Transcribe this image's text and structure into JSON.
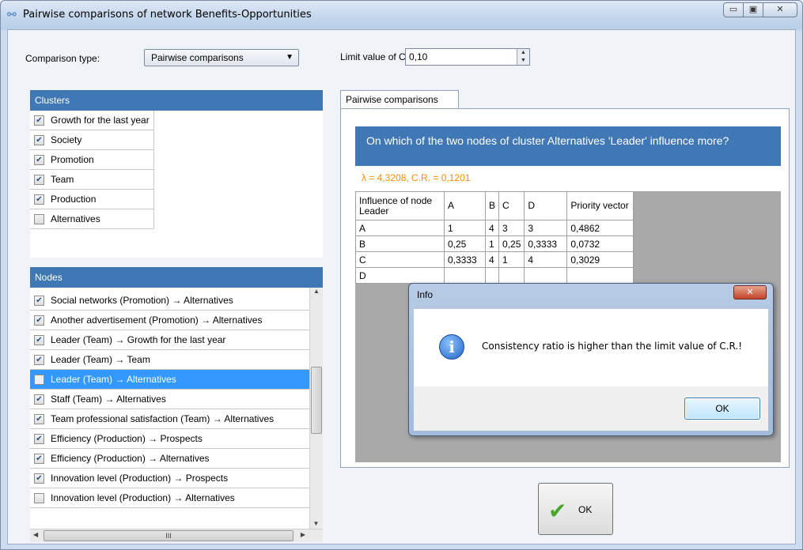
{
  "window": {
    "title": "Pairwise comparisons of network Benefits-Opportunities",
    "min": "▭",
    "max": "▣",
    "close": "✕"
  },
  "controls": {
    "comparison_type_label": "Comparison type:",
    "comparison_type_value": "Pairwise comparisons",
    "limit_label": "Limit value of C.R.",
    "limit_value": "0,10"
  },
  "clusters": {
    "header": "Clusters",
    "items": [
      {
        "label": "Growth for the last year",
        "checked": true
      },
      {
        "label": "Society",
        "checked": true
      },
      {
        "label": "Promotion",
        "checked": true
      },
      {
        "label": "Team",
        "checked": true
      },
      {
        "label": "Production",
        "checked": true
      },
      {
        "label": "Alternatives",
        "checked": false
      }
    ]
  },
  "nodes": {
    "header": "Nodes",
    "items": [
      {
        "label": "Social networks (Promotion) → Alternatives",
        "checked": true
      },
      {
        "label": "Another advertisement (Promotion) → Alternatives",
        "checked": true
      },
      {
        "label": "Leader (Team) → Growth for the last year",
        "checked": true
      },
      {
        "label": "Leader (Team) → Team",
        "checked": true
      },
      {
        "label": "Leader (Team) → Alternatives",
        "checked": false,
        "selected": true
      },
      {
        "label": "Staff (Team) → Alternatives",
        "checked": true
      },
      {
        "label": "Team professional satisfaction (Team) → Alternatives",
        "checked": true
      },
      {
        "label": "Efficiency (Production) → Prospects",
        "checked": true
      },
      {
        "label": "Efficiency (Production) → Alternatives",
        "checked": true
      },
      {
        "label": "Innovation level (Production) → Prospects",
        "checked": true
      },
      {
        "label": "Innovation level (Production) → Alternatives",
        "checked": false
      }
    ],
    "scroll_grip": "III"
  },
  "tab": {
    "label": "Pairwise comparisons",
    "question": "On which of the two nodes of cluster Alternatives 'Leader'  influence more?",
    "cr_line": "λ = 4,3208,  C.R. = 0,1201",
    "matrix": {
      "corner": "Influence of node Leader",
      "columns": [
        "A",
        "B",
        "C",
        "D",
        "Priority vector"
      ],
      "rows": [
        {
          "name": "A",
          "cells": [
            "1",
            "4",
            "3",
            "3",
            "0,4862"
          ]
        },
        {
          "name": "B",
          "cells": [
            "0,25",
            "1",
            "0,25",
            "0,3333",
            "0,0732"
          ]
        },
        {
          "name": "C",
          "cells": [
            "0,3333",
            "4",
            "1",
            "4",
            "0,3029"
          ]
        },
        {
          "name": "D",
          "cells": [
            "",
            "",
            "",
            "",
            ""
          ]
        }
      ]
    }
  },
  "ok_button": "OK",
  "dialog": {
    "title": "Info",
    "close": "✕",
    "message": "Consistency ratio is higher than the limit value of C.R.!",
    "ok": "OK",
    "icon": "info-icon"
  }
}
